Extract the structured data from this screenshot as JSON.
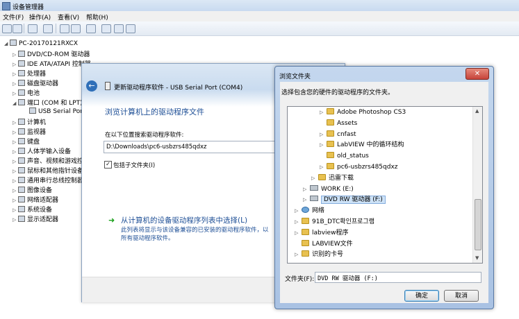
{
  "device_manager": {
    "title": "设备管理器",
    "menu": [
      "文件(F)",
      "操作(A)",
      "查看(V)",
      "帮助(H)"
    ],
    "computer": "PC-20170121RXCX",
    "tree": [
      {
        "label": "DVD/CD-ROM 驱动器",
        "expanded": false
      },
      {
        "label": "IDE ATA/ATAPI 控制器",
        "expanded": false
      },
      {
        "label": "处理器",
        "expanded": false
      },
      {
        "label": "磁盘驱动器",
        "expanded": false
      },
      {
        "label": "电池",
        "expanded": false
      },
      {
        "label": "端口 (COM 和 LPT)",
        "expanded": true
      },
      {
        "label": "USB Serial Port",
        "child": true
      },
      {
        "label": "计算机",
        "expanded": false
      },
      {
        "label": "监视器",
        "expanded": false
      },
      {
        "label": "键盘",
        "expanded": false
      },
      {
        "label": "人体学输入设备",
        "expanded": false
      },
      {
        "label": "声音、视频和游戏控制器",
        "expanded": false
      },
      {
        "label": "鼠标和其他指针设备",
        "expanded": false
      },
      {
        "label": "通用串行总线控制器",
        "expanded": false
      },
      {
        "label": "图像设备",
        "expanded": false
      },
      {
        "label": "网络适配器",
        "expanded": false
      },
      {
        "label": "系统设备",
        "expanded": false
      },
      {
        "label": "显示适配器",
        "expanded": false
      }
    ]
  },
  "update_driver": {
    "title": "更新驱动程序软件 - USB Serial Port (COM4)",
    "heading": "浏览计算机上的驱动程序文件",
    "search_label": "在以下位置搜索驱动程序软件:",
    "path_value": "D:\\Downloads\\pc6-usbzrs485qdxz",
    "include_subfolders_label": "包括子文件夹(I)",
    "include_subfolders_checked": true,
    "pick_link": "从计算机的设备驱动程序列表中选择(L)",
    "pick_desc_line1": "此列表将显示与该设备兼容的已安装的驱动程序软件，以",
    "pick_desc_line2": "所有驱动程序软件。"
  },
  "browse_folder": {
    "title": "浏览文件夹",
    "description": "选择包含您的硬件的驱动程序的文件夹。",
    "tree": [
      {
        "label": "Adobe Photoshop CS3",
        "type": "folder",
        "indent": 2,
        "arrow": "▷"
      },
      {
        "label": "Assets",
        "type": "folder",
        "indent": 2,
        "arrow": ""
      },
      {
        "label": "cnfast",
        "type": "folder",
        "indent": 2,
        "arrow": "▷"
      },
      {
        "label": "LabVIEW 中的循环结构",
        "type": "folder",
        "indent": 2,
        "arrow": "▷"
      },
      {
        "label": "old_status",
        "type": "folder",
        "indent": 2,
        "arrow": ""
      },
      {
        "label": "pc6-usbzrs485qdxz",
        "type": "folder",
        "indent": 2,
        "arrow": "▷"
      },
      {
        "label": "迅雷下载",
        "type": "folder",
        "indent": 1,
        "arrow": "▷"
      },
      {
        "label": "WORK (E:)",
        "type": "drive",
        "indent": 0,
        "arrow": "▷"
      },
      {
        "label": "DVD RW 驱动器 (F:)",
        "type": "drive",
        "indent": 0,
        "arrow": "▷",
        "selected": true
      },
      {
        "label": "网络",
        "type": "net",
        "indent": -1,
        "arrow": "▷"
      },
      {
        "label": "91B_DTC확인프로그램",
        "type": "folder",
        "indent": -1,
        "arrow": "▷"
      },
      {
        "label": "labview程序",
        "type": "folder",
        "indent": -1,
        "arrow": "▷"
      },
      {
        "label": "LABVIEW文件",
        "type": "folder",
        "indent": -1,
        "arrow": ""
      },
      {
        "label": "识别的卡号",
        "type": "folder",
        "indent": -1,
        "arrow": "▷"
      }
    ],
    "folder_label": "文件夹(F):",
    "folder_value": "DVD RW 驱动器 (F:)",
    "ok_label": "确定",
    "cancel_label": "取消"
  }
}
